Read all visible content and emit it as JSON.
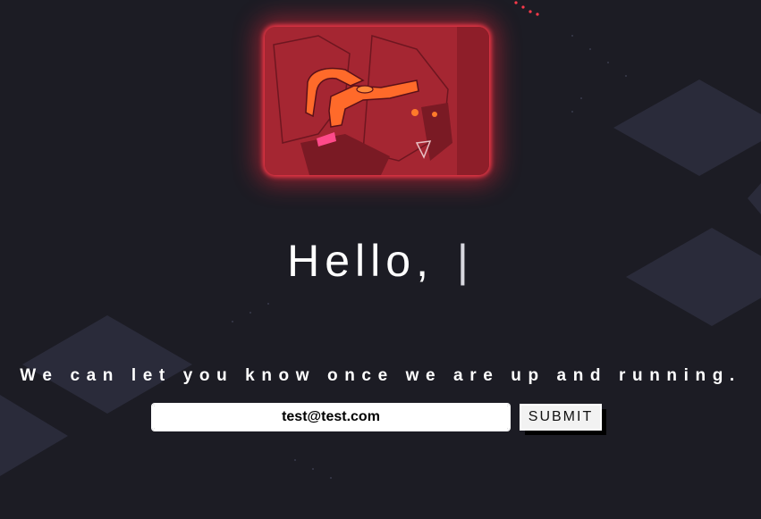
{
  "hero": {
    "image_icon": "robot-illustration",
    "glow_color": "#ff3a4a",
    "tint_color": "#a02430"
  },
  "greeting": {
    "text": "Hello,",
    "cursor": "|"
  },
  "signup": {
    "tagline": "We can let you know once we are up and running.",
    "email_value": "test@test.com",
    "submit_label": "SUBMIT"
  },
  "theme": {
    "background": "#1c1c24",
    "shape_color": "#2a2b3a",
    "accent": "#ff3a4a"
  }
}
